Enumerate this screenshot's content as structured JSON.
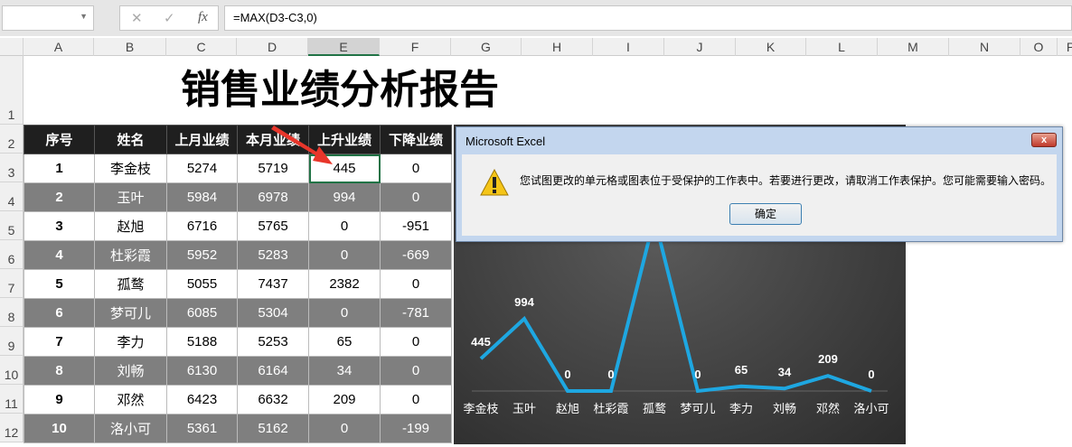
{
  "formula_bar": {
    "name_box": "",
    "formula": "=MAX(D3-C3,0)",
    "cancel_icon": "✕",
    "enter_icon": "✓",
    "fx_label": "fx"
  },
  "columns": [
    "A",
    "B",
    "C",
    "D",
    "E",
    "F",
    "G",
    "H",
    "I",
    "J",
    "K",
    "L",
    "M",
    "N",
    "O",
    "P"
  ],
  "selected_column": "E",
  "rows": [
    "1",
    "2",
    "3",
    "4",
    "5",
    "6",
    "7",
    "8",
    "9",
    "10",
    "11",
    "12"
  ],
  "title": "销售业绩分析报告",
  "table": {
    "headers": [
      "序号",
      "姓名",
      "上月业绩",
      "本月业绩",
      "上升业绩",
      "下降业绩"
    ],
    "rows": [
      [
        "1",
        "李金枝",
        "5274",
        "5719",
        "445",
        "0"
      ],
      [
        "2",
        "玉叶",
        "5984",
        "6978",
        "994",
        "0"
      ],
      [
        "3",
        "赵旭",
        "6716",
        "5765",
        "0",
        "-951"
      ],
      [
        "4",
        "杜彩霞",
        "5952",
        "5283",
        "0",
        "-669"
      ],
      [
        "5",
        "孤鹜",
        "5055",
        "7437",
        "2382",
        "0"
      ],
      [
        "6",
        "梦可儿",
        "6085",
        "5304",
        "0",
        "-781"
      ],
      [
        "7",
        "李力",
        "5188",
        "5253",
        "65",
        "0"
      ],
      [
        "8",
        "刘畅",
        "6130",
        "6164",
        "34",
        "0"
      ],
      [
        "9",
        "邓然",
        "6423",
        "6632",
        "209",
        "0"
      ],
      [
        "10",
        "洛小可",
        "5361",
        "5162",
        "0",
        "-199"
      ]
    ]
  },
  "chart_data": {
    "type": "line",
    "categories": [
      "李金枝",
      "玉叶",
      "赵旭",
      "杜彩霞",
      "孤鹜",
      "梦可儿",
      "李力",
      "刘畅",
      "邓然",
      "洛小可"
    ],
    "values": [
      445,
      994,
      0,
      0,
      2382,
      0,
      65,
      34,
      209,
      0
    ],
    "data_labels": [
      "445",
      "994",
      "0",
      "0",
      "",
      "0",
      "65",
      "34",
      "209",
      "0"
    ],
    "line_color": "#1ea7e1",
    "background": "dark-gradient"
  },
  "dialog": {
    "title": "Microsoft Excel",
    "message": "您试图更改的单元格或图表位于受保护的工作表中。若要进行更改，请取消工作表保护。您可能需要输入密码。",
    "ok_label": "确定",
    "close_label": "x",
    "icon": "warning-icon"
  },
  "accent_colors": {
    "selection": "#217346",
    "arrow": "#e8362b"
  }
}
